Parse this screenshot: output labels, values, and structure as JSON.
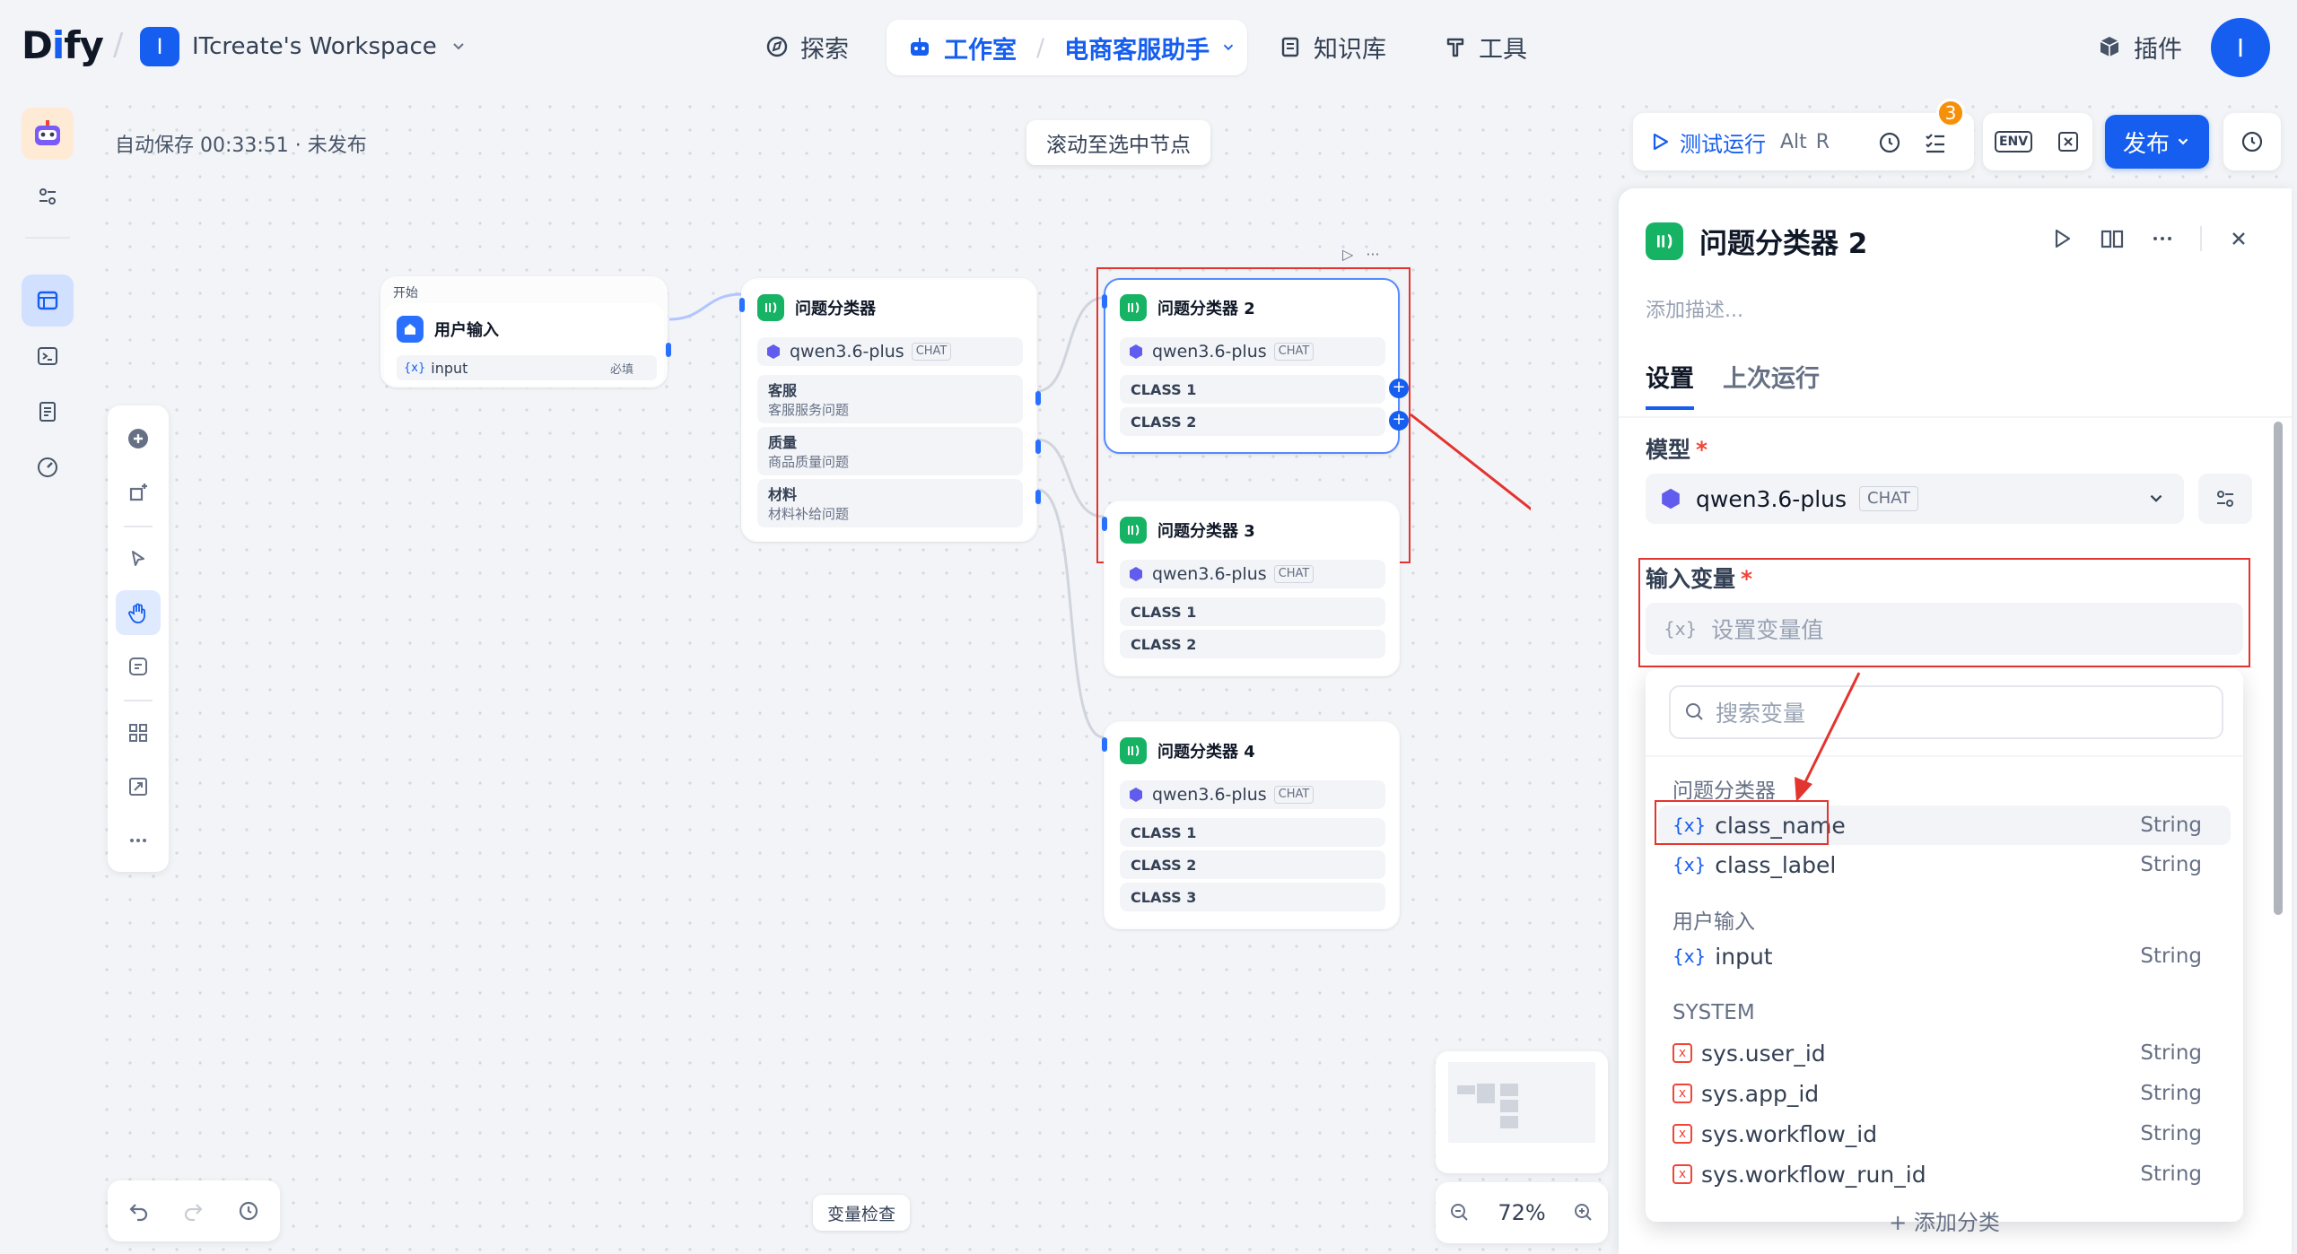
{
  "app": {
    "logo_text": "Dify",
    "workspace_initial": "I",
    "workspace_name": "ITcreate's Workspace",
    "user_initial": "I"
  },
  "nav": {
    "explore": "探索",
    "studio": "工作室",
    "app_name": "电商客服助手",
    "knowledge": "知识库",
    "tools": "工具",
    "plugins": "插件"
  },
  "canvas": {
    "autosave": "自动保存 00:33:51 · 未发布",
    "scroll_to_node": "滚动至选中节点",
    "var_inspect": "变量检查",
    "zoom": "72%"
  },
  "toolbar": {
    "test_run": "测试运行",
    "shortcut_alt": "Alt",
    "shortcut_r": "R",
    "checklist_count": "3",
    "env": "ENV",
    "publish": "发布"
  },
  "nodes": {
    "start": {
      "tag": "开始",
      "title": "用户输入",
      "var": "input",
      "required": "必填"
    },
    "classifier1": {
      "title": "问题分类器",
      "model": "qwen3.6-plus",
      "mode": "CHAT",
      "topics": [
        {
          "name": "客服",
          "desc": "客服服务问题"
        },
        {
          "name": "质量",
          "desc": "商品质量问题"
        },
        {
          "name": "材料",
          "desc": "材料补给问题"
        }
      ]
    },
    "classifier2": {
      "title": "问题分类器 2",
      "model": "qwen3.6-plus",
      "mode": "CHAT",
      "classes": [
        "CLASS 1",
        "CLASS 2"
      ]
    },
    "classifier3": {
      "title": "问题分类器 3",
      "model": "qwen3.6-plus",
      "mode": "CHAT",
      "classes": [
        "CLASS 1",
        "CLASS 2"
      ]
    },
    "classifier4": {
      "title": "问题分类器 4",
      "model": "qwen3.6-plus",
      "mode": "CHAT",
      "classes": [
        "CLASS 1",
        "CLASS 2",
        "CLASS 3"
      ]
    }
  },
  "panel": {
    "title": "问题分类器 2",
    "desc_placeholder": "添加描述...",
    "tabs": [
      "设置",
      "上次运行"
    ],
    "model_label": "模型",
    "model_name": "qwen3.6-plus",
    "model_mode": "CHAT",
    "input_var_label": "输入变量",
    "input_var_placeholder": "设置变量值",
    "search_placeholder": "搜索变量",
    "add_class": "+ 添加分类",
    "groups": [
      {
        "name": "问题分类器",
        "items": [
          {
            "name": "class_name",
            "type": "String"
          },
          {
            "name": "class_label",
            "type": "String"
          }
        ]
      },
      {
        "name": "用户输入",
        "items": [
          {
            "name": "input",
            "type": "String"
          }
        ]
      },
      {
        "name": "SYSTEM",
        "items": [
          {
            "name": "sys.user_id",
            "type": "String"
          },
          {
            "name": "sys.app_id",
            "type": "String"
          },
          {
            "name": "sys.workflow_id",
            "type": "String"
          },
          {
            "name": "sys.workflow_run_id",
            "type": "String"
          }
        ]
      }
    ]
  },
  "colors": {
    "accent": "#155eef",
    "classifier_icon": "#16b364",
    "annotation_red": "#e3342f",
    "badge": "#f79009"
  }
}
